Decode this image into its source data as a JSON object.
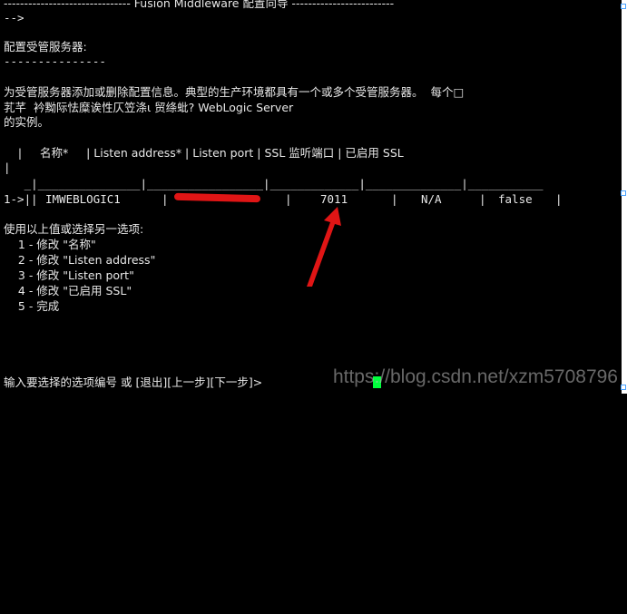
{
  "terminal": {
    "header_line": "------------------------------- Fusion Middleware 配置向导 -------------------------",
    "header_arrow": "-->",
    "section_title": "配置受管服务器:",
    "section_underline": "---------------",
    "desc_line1": "为受管服务器添加或删除配置信息。典型的生产环境都具有一个或多个受管服务器。  每个□",
    "desc_line2": "芤芊  衿黝际怯糜诶性仄笠涤ι 贸绦蚍? WebLogic Server",
    "desc_line3": "的实例。",
    "table_header": "    |     名称*     | Listen address* | Listen port | SSL 监听端口 | 已启用 SSL",
    "table_header_cont": "|",
    "table_sep": "   _|_______________|_________________|_____________|______________|___________",
    "table_row_prefix": "1->|",
    "table_row": {
      "name": "IMWEBLOGIC1",
      "listen_address": "",
      "listen_port": "7011",
      "ssl_port": "N/A",
      "ssl_enabled": "false"
    },
    "prompt_intro": "使用以上值或选择另一选项:",
    "options": [
      "    1 - 修改 \"名称\"",
      "    2 - 修改 \"Listen address\"",
      "    3 - 修改 \"Listen port\"",
      "    4 - 修改 \"已启用 SSL\"",
      "    5 - 完成"
    ],
    "input_prompt": "输入要选择的选项编号 或 [退出][上一步][下一步]>"
  },
  "watermark": "https://blog.csdn.net/xzm5708796",
  "colors": {
    "background": "#000000",
    "text": "#e8e8e8",
    "cursor": "#00ff3c",
    "annotation": "#e01515"
  }
}
